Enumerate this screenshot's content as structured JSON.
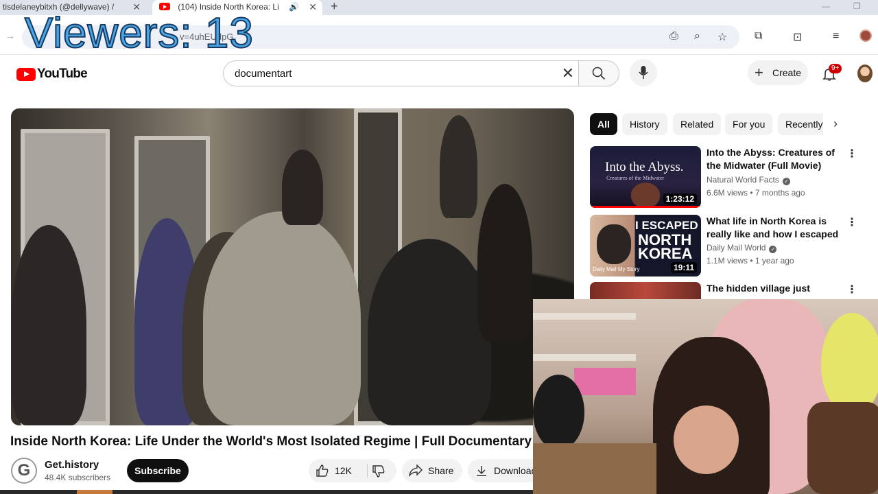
{
  "browser": {
    "tabs": [
      {
        "title": "tisdelaneybitxh (@dellywave) /",
        "active": false
      },
      {
        "title": "(104) Inside North Korea: Li",
        "active": true
      }
    ],
    "new_tab": "+",
    "url_fragment": "v=4uhEUdpG",
    "close_glyph": "✕",
    "min_glyph": "—",
    "restore_glyph": "❐"
  },
  "overlay": {
    "viewers_label": "Viewers: 13"
  },
  "youtube": {
    "logo_text": "YouTube",
    "search": {
      "value": "documentart",
      "placeholder": "Search"
    },
    "create_label": "Create",
    "notifications_badge": "9+"
  },
  "video": {
    "title": "Inside North Korea: Life Under the World's Most Isolated Regime | Full Documentary",
    "channel_initial": "G",
    "channel_name": "Get.history",
    "subscribers": "48.4K subscribers",
    "subscribe_label": "Subscribe",
    "likes": "12K",
    "share_label": "Share",
    "download_label": "Download"
  },
  "chips": [
    "All",
    "History",
    "Related",
    "For you",
    "Recently uploaded"
  ],
  "recommendations": [
    {
      "title": "Into the Abyss: Creatures of the Midwater (Full Movie)",
      "channel": "Natural World Facts",
      "meta": "6.6M views • 7 months ago",
      "duration": "1:23:12",
      "thumb_title": "Into the Abyss.",
      "thumb_sub": "Creatures of the Midwater"
    },
    {
      "title": "What life in North Korea is really like and how I escaped | MY ...",
      "channel": "Daily Mail World",
      "meta": "1.1M views • 1 year ago",
      "duration": "19:11",
      "thumb_line1": "I ESCAPED",
      "thumb_line2": "NORTH",
      "thumb_line3": "KOREA",
      "thumb_brand": "Daily Mail My Story"
    },
    {
      "title": "The hidden village just metres"
    }
  ],
  "colors": {
    "youtube_red": "#ff0000",
    "viewers_fill": "#4aa7e6",
    "viewers_stroke": "#163a63",
    "badge": "#cc0000"
  }
}
